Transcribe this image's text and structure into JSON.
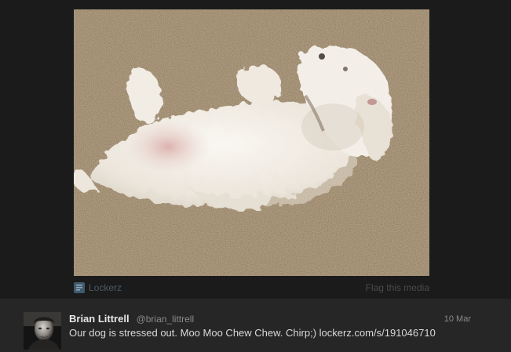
{
  "media": {
    "source_label": "Lockerz",
    "source_icon": "lockerz-icon",
    "flag_label": "Flag this media"
  },
  "tweet": {
    "author_name": "Brian Littrell",
    "author_handle": "@brian_littrell",
    "timestamp": "10 Mar",
    "text": "Our dog is stressed out. Moo Moo Chew Chew. Chirp;)",
    "link": "lockerz.com/s/191046710"
  },
  "colors": {
    "background": "#1b1b1b",
    "tweet_background": "#262626",
    "source_icon": "#3f5a6c"
  }
}
